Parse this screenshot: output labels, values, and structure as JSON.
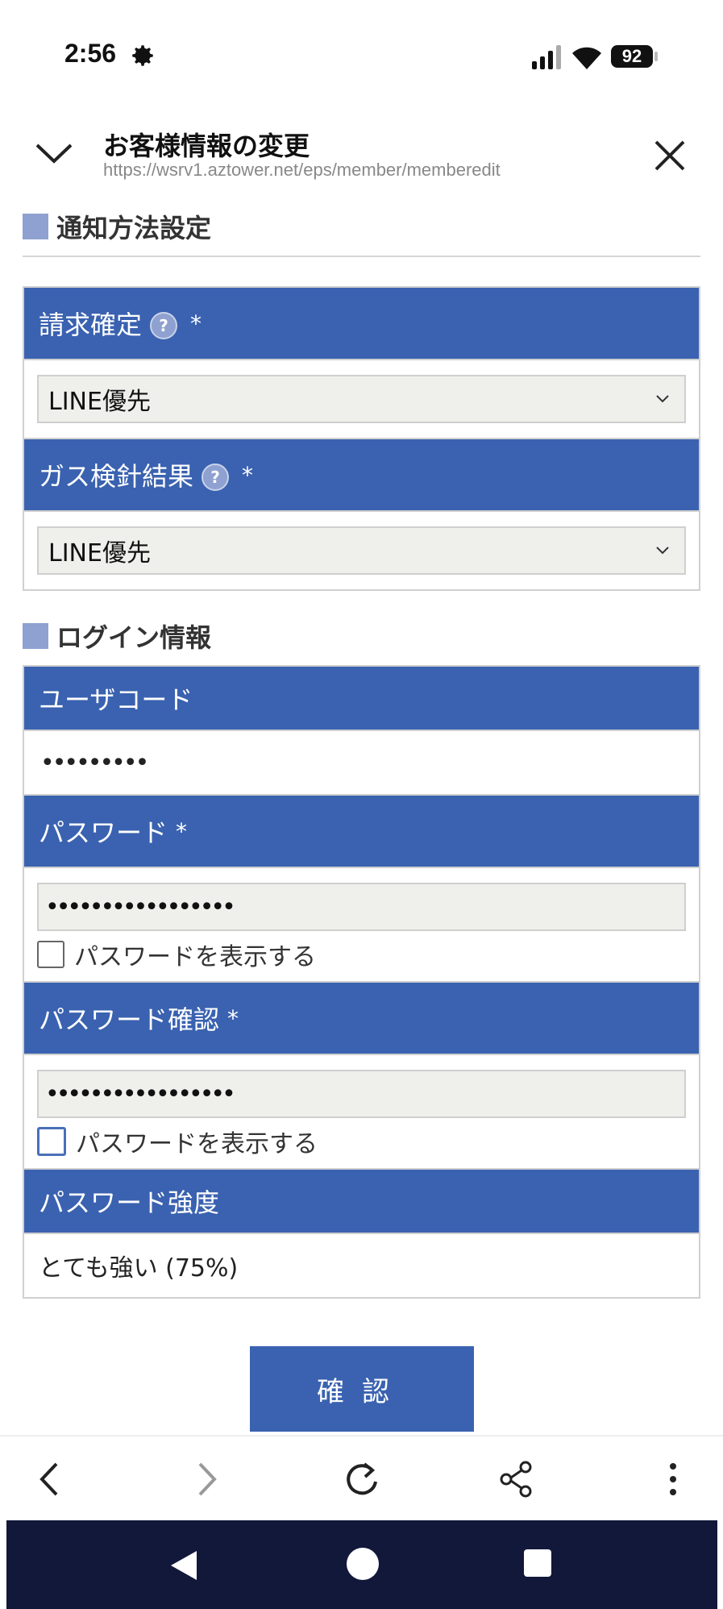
{
  "status_bar": {
    "time": "2:56",
    "battery": "92"
  },
  "header": {
    "title": "お客様情報の変更",
    "url": "https://wsrv1.aztower.net/eps/member/memberedit"
  },
  "notification_section": {
    "heading": "通知方法設定",
    "fields": [
      {
        "label": "請求確定",
        "required": "*",
        "value": "LINE優先"
      },
      {
        "label": "ガス検針結果",
        "required": "*",
        "value": "LINE優先"
      }
    ]
  },
  "login_section": {
    "heading": "ログイン情報",
    "user_code": {
      "label": "ユーザコード",
      "value": "•••••••••"
    },
    "password": {
      "label": "パスワード",
      "required": "*",
      "value": "•••••••••••••••••",
      "show_label": "パスワードを表示する"
    },
    "password_confirm": {
      "label": "パスワード確認",
      "required": "*",
      "value": "•••••••••••••••••",
      "show_label": "パスワードを表示する"
    },
    "strength": {
      "label": "パスワード強度",
      "value": "とても強い (75%)"
    }
  },
  "confirm_button": "確認",
  "help_glyph": "?",
  "colors": {
    "accent": "#3a62b0",
    "section_marker": "#8ea1d0",
    "nav_bar": "#12183a"
  }
}
